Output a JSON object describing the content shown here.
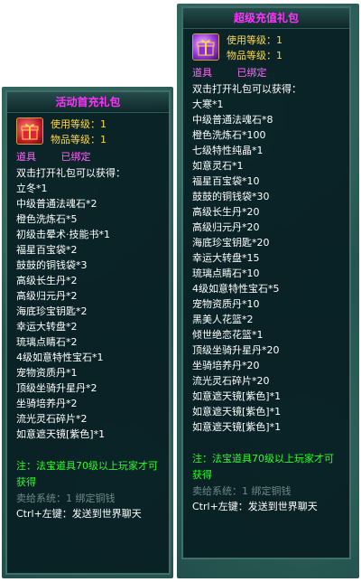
{
  "left": {
    "title": "活动首充礼包",
    "use_level": "使用等级：1",
    "item_level": "物品等级：1",
    "tag_item": "道具",
    "tag_bound": "已绑定",
    "intro": "双击打开礼包可以获得：",
    "rewards": [
      "立冬*1",
      "中级普通法魂石*2",
      "橙色洗炼石*5",
      "初级击晕术·技能书*1",
      "福星百宝袋*2",
      "鼓鼓的铜钱袋*3",
      "高级长生丹*2",
      "高级归元丹*2",
      "海底珍宝钥匙*2",
      "幸运大转盘*2",
      "琉璃点睛石*2",
      "4级如意特性宝石*1",
      "宠物资质丹*1",
      "顶级坐骑升星丹*2",
      "坐骑培养丹*2",
      "流光灵石碎片*2",
      "如意遮天镜[紫色]*1"
    ],
    "note": "注：法宝道具70级以上玩家才可获得",
    "trade": "卖给系统：1 绑定铜钱",
    "hint": "Ctrl+左键：发送到世界聊天"
  },
  "right": {
    "title": "超级充值礼包",
    "use_level": "使用等级：1",
    "item_level": "物品等级：1",
    "tag_item": "道具",
    "tag_bound": "已绑定",
    "intro": "双击打开礼包可以获得：",
    "rewards": [
      "大寒*1",
      "中级普通法魂石*8",
      "橙色洗炼石*100",
      "七级特性纯晶*1",
      "如意灵石*1",
      "福星百宝袋*10",
      "鼓鼓的铜钱袋*30",
      "高级长生丹*20",
      "高级归元丹*20",
      "海底珍宝钥匙*20",
      "幸运大转盘*15",
      "琉璃点睛石*10",
      "4级如意特性宝石*5",
      "宠物资质丹*10",
      "黑美人花篮*2",
      "倾世绝恋花篮*1",
      "顶级坐骑升星丹*20",
      "坐骑培养丹*20",
      "流光灵石碎片*20",
      "如意遮天镜[紫色]*1",
      "如意遮天镜[紫色]*1",
      "如意遮天镜[紫色]*1"
    ],
    "note": "注：法宝道具70级以上玩家才可获得",
    "trade": "卖给系统：1 绑定铜钱",
    "hint": "Ctrl+左键：发送到世界聊天"
  }
}
